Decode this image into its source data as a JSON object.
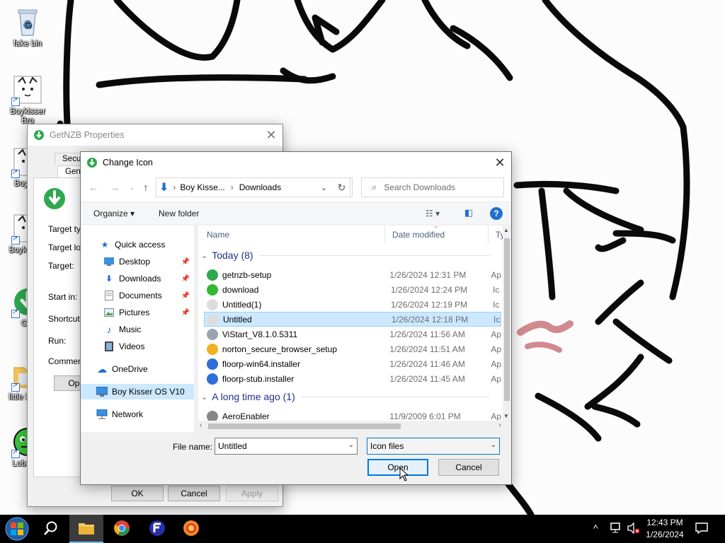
{
  "desktop": {
    "icons": [
      {
        "label": "fake bin",
        "icon": "recycle-bin-icon"
      },
      {
        "label": "Boykisser Bro",
        "icon": "boykisser-browser-icon"
      },
      {
        "label": "Boyk Fi",
        "icon": "boykisser-files-icon"
      },
      {
        "label": "Boyk Start",
        "icon": "boykisser-start-icon"
      },
      {
        "label": "Get",
        "icon": "getnzb-icon"
      },
      {
        "label": "little kisser",
        "icon": "folder-icon"
      },
      {
        "label": "Lobo Hu",
        "icon": "green-creature-icon"
      }
    ]
  },
  "properties": {
    "title": "GetNZB Properties",
    "tabs": {
      "security": "Security",
      "general": "General"
    },
    "labels": {
      "target_type": "Target typ",
      "target_location": "Target loc",
      "target": "Target:",
      "start_in": "Start in:",
      "shortcut_key": "Shortcut k",
      "run": "Run:",
      "comment": "Comment:"
    },
    "open_file_location": "Open",
    "ok": "OK",
    "cancel": "Cancel",
    "apply": "Apply"
  },
  "dialog": {
    "title": "Change Icon",
    "breadcrumb": {
      "root": "Boy Kisse...",
      "current": "Downloads"
    },
    "search_placeholder": "Search Downloads",
    "organize": "Organize",
    "new_folder": "New folder",
    "help": "?",
    "nav": [
      {
        "label": "Quick access",
        "icon": "star-icon",
        "pinned": false
      },
      {
        "label": "Desktop",
        "icon": "desktop-icon",
        "pinned": true
      },
      {
        "label": "Downloads",
        "icon": "downloads-icon",
        "pinned": true
      },
      {
        "label": "Documents",
        "icon": "documents-icon",
        "pinned": true
      },
      {
        "label": "Pictures",
        "icon": "pictures-icon",
        "pinned": true
      },
      {
        "label": "Music",
        "icon": "music-icon",
        "pinned": false
      },
      {
        "label": "Videos",
        "icon": "videos-icon",
        "pinned": false
      },
      {
        "label": "OneDrive",
        "icon": "onedrive-icon",
        "pinned": false
      },
      {
        "label": "Boy Kisser OS V10",
        "icon": "this-pc-icon",
        "pinned": false
      },
      {
        "label": "Network",
        "icon": "network-icon",
        "pinned": false
      }
    ],
    "columns": {
      "name": "Name",
      "date": "Date modified",
      "type": "Ty"
    },
    "groups": [
      {
        "label": "Today (8)",
        "files": [
          {
            "name": "getnzb-setup",
            "date": "1/26/2024 12:31 PM",
            "type": "Ap",
            "color": "#2fa84f"
          },
          {
            "name": "download",
            "date": "1/26/2024 12:24 PM",
            "type": "Ic",
            "color": "#30b830"
          },
          {
            "name": "Untitled(1)",
            "date": "1/26/2024 12:19 PM",
            "type": "Ic",
            "color": "#dddddd"
          },
          {
            "name": "Untitled",
            "date": "1/26/2024 12:18 PM",
            "type": "Ic",
            "color": "#dddddd"
          },
          {
            "name": "ViStart_V8.1.0.5311",
            "date": "1/26/2024 11:56 AM",
            "type": "Ap",
            "color": "#9aa4b0"
          },
          {
            "name": "norton_secure_browser_setup",
            "date": "1/26/2024 11:51 AM",
            "type": "Ap",
            "color": "#f2b01e"
          },
          {
            "name": "floorp-win64.installer",
            "date": "1/26/2024 11:46 AM",
            "type": "Ap",
            "color": "#2d6fd6"
          },
          {
            "name": "floorp-stub.installer",
            "date": "1/26/2024 11:45 AM",
            "type": "Ap",
            "color": "#2d6fd6"
          }
        ]
      },
      {
        "label": "A long time ago (1)",
        "files": [
          {
            "name": "AeroEnabler",
            "date": "11/9/2009 6:01 PM",
            "type": "Ap",
            "color": "#888888"
          }
        ]
      }
    ],
    "selected_file": "Untitled",
    "file_name_label": "File name:",
    "file_name_value": "Untitled",
    "file_type": "Icon files",
    "open": "Open",
    "cancel": "Cancel"
  },
  "taskbar": {
    "time": "12:43 PM",
    "date": "1/26/2024"
  }
}
